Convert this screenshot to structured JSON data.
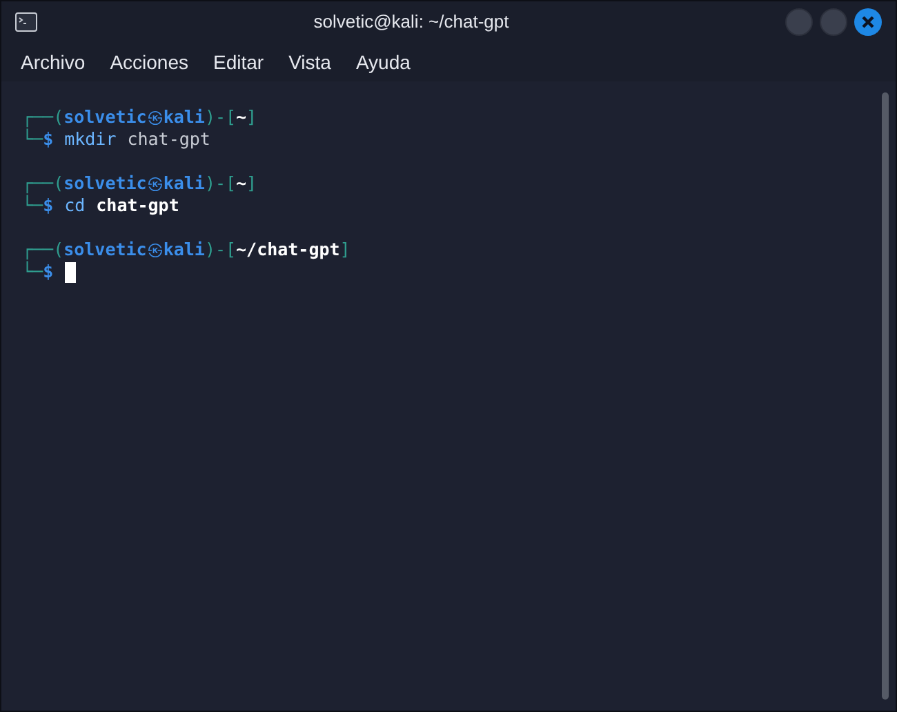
{
  "window": {
    "title": "solvetic@kali: ~/chat-gpt"
  },
  "menu": [
    "Archivo",
    "Acciones",
    "Editar",
    "Vista",
    "Ayuda"
  ],
  "prompts": [
    {
      "corner_top": "┌──",
      "open": "(",
      "user": "solvetic",
      "at": "㉿",
      "host": "kali",
      "close": ")",
      "dash": "-",
      "dir_open": "[",
      "dir": "~",
      "dir_close": "]",
      "corner_bottom": "└─",
      "dollar": "$",
      "command": "mkdir",
      "argument": "chat-gpt",
      "argument_bold": false,
      "cursor": false
    },
    {
      "corner_top": "┌──",
      "open": "(",
      "user": "solvetic",
      "at": "㉿",
      "host": "kali",
      "close": ")",
      "dash": "-",
      "dir_open": "[",
      "dir": "~",
      "dir_close": "]",
      "corner_bottom": "└─",
      "dollar": "$",
      "command": "cd",
      "argument": "chat-gpt",
      "argument_bold": true,
      "cursor": false
    },
    {
      "corner_top": "┌──",
      "open": "(",
      "user": "solvetic",
      "at": "㉿",
      "host": "kali",
      "close": ")",
      "dash": "-",
      "dir_open": "[",
      "dir": "~/chat-gpt",
      "dir_close": "]",
      "corner_bottom": "└─",
      "dollar": "$",
      "cursor": true
    }
  ]
}
